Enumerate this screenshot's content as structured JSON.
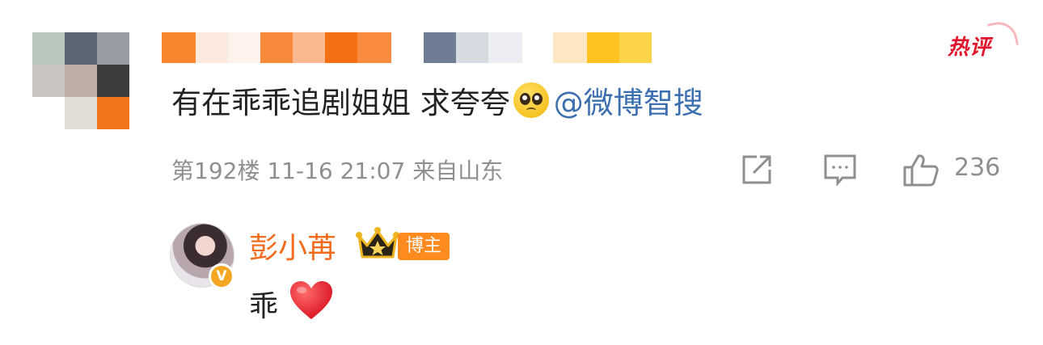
{
  "hot_badge": "热评",
  "comment": {
    "text": "有在乖乖追剧姐姐 求夸夸",
    "emoji": "pleading-face-emoji",
    "mention": "@微博智搜",
    "meta": "第192楼 11-16 21:07 来自山东",
    "like_count": "236"
  },
  "reply": {
    "name": "彭小苒",
    "badge": "博主",
    "verified_mark": "V",
    "text": "乖",
    "emoji": "red-heart-emoji"
  },
  "colors": {
    "mention": "#3c6fb0",
    "reply_name": "#f26a1b",
    "host_badge": "#ff8a1e",
    "hot_badge": "#e0142a",
    "meta": "#8f8f8f"
  },
  "icons": [
    "share-icon",
    "comment-icon",
    "like-icon",
    "crown-icon",
    "verified-icon"
  ]
}
